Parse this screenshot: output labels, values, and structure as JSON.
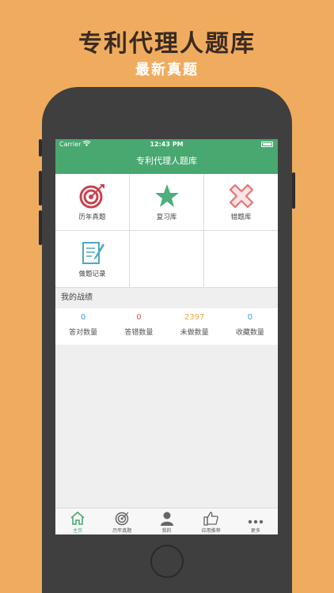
{
  "promo": {
    "headline": "专利代理人题库",
    "subline": "最新真题"
  },
  "status_bar": {
    "carrier": "Carrier",
    "time": "12:43 PM"
  },
  "nav": {
    "title": "专利代理人题库"
  },
  "grid_items": [
    {
      "label": "历年真题",
      "icon": "target-icon",
      "color": "#c9424f"
    },
    {
      "label": "复习库",
      "icon": "star-icon",
      "color": "#4caf7d"
    },
    {
      "label": "错题库",
      "icon": "cross-icon",
      "color": "#e86e6e"
    },
    {
      "label": "做题记录",
      "icon": "notepad-icon",
      "color": "#4fa6c9"
    }
  ],
  "section": {
    "title": "我的战绩"
  },
  "stats": [
    {
      "value": "0",
      "label": "答对数量",
      "color": "#3d9bd0"
    },
    {
      "value": "0",
      "label": "答错数量",
      "color": "#e2574c"
    },
    {
      "value": "2397",
      "label": "未做数量",
      "color": "#e8a93a"
    },
    {
      "value": "0",
      "label": "收藏数量",
      "color": "#3d9bd0"
    }
  ],
  "tabs": [
    {
      "label": "主页",
      "icon": "home-icon",
      "active": true
    },
    {
      "label": "历年真题",
      "icon": "target-icon",
      "active": false
    },
    {
      "label": "我的",
      "icon": "user-icon",
      "active": false
    },
    {
      "label": "应用推荐",
      "icon": "thumbs-up-icon",
      "active": false
    },
    {
      "label": "更多",
      "icon": "more-icon",
      "active": false
    }
  ]
}
